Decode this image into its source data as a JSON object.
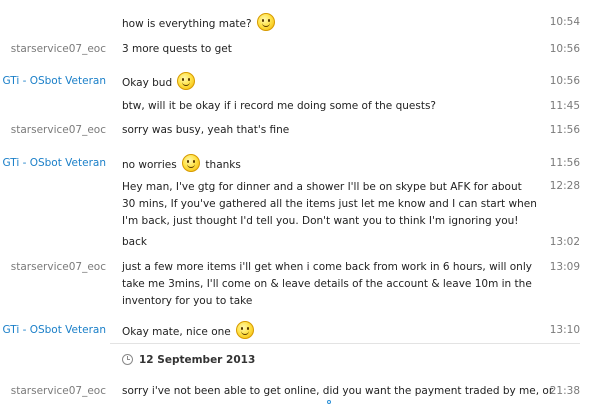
{
  "messages": [
    {
      "sender": "",
      "text": "how is everything mate?",
      "time": "10:54",
      "emoji": "smile-emoji"
    },
    {
      "sender": "starservice07_eoc",
      "text": "3 more quests to get",
      "time": "10:56"
    },
    {
      "sender": "GTi - OSbot Veteran",
      "text": "Okay bud",
      "time": "10:56",
      "emoji": "smile-emoji"
    },
    {
      "sender": "",
      "text": "btw, will it be okay if i record me doing some of the quests?",
      "time": "11:45"
    },
    {
      "sender": "starservice07_eoc",
      "text": "sorry was busy, yeah that's fine",
      "time": "11:56"
    },
    {
      "sender": "GTi - OSbot Veteran",
      "text_before": "no worries",
      "text_after": "thanks",
      "time": "11:56",
      "emoji": "smile-emoji"
    },
    {
      "sender": "",
      "text": "Hey man, I've gtg for dinner and a shower I'll be on skype but AFK for about 30 mins, If you've gathered all the items just let me know and I can start when I'm back, just thought I'd tell you. Don't want you to think I'm ignoring you!",
      "time": "12:28"
    },
    {
      "sender": "",
      "text": "back",
      "time": "13:02"
    },
    {
      "sender": "starservice07_eoc",
      "text": "just a few more items i'll get when i come back from work in 6 hours, will only take me 3mins, I'll come on & leave details of the account & leave 10m in the inventory for you to take",
      "time": "13:09"
    },
    {
      "sender": "GTi - OSbot Veteran",
      "text": "Okay mate, nice one",
      "time": "13:10",
      "emoji": "smile-emoji"
    },
    {
      "sender": "starservice07_eoc",
      "text": "sorry i've not been able to get online, did you want the payment traded by me, or",
      "time": "21:38"
    }
  ],
  "date_separator": {
    "label": "12 September 2013",
    "icon": "clock-icon"
  },
  "colors": {
    "self_sender": "#1a7fc8",
    "other_sender": "#7a7a7a",
    "text": "#1f1f1f"
  }
}
